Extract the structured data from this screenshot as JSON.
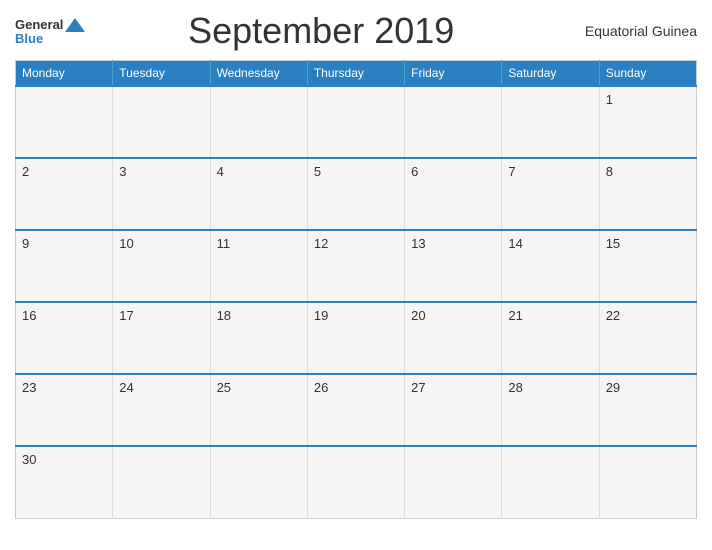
{
  "header": {
    "logo_general": "General",
    "logo_blue": "Blue",
    "title": "September 2019",
    "country": "Equatorial Guinea"
  },
  "days": [
    "Monday",
    "Tuesday",
    "Wednesday",
    "Thursday",
    "Friday",
    "Saturday",
    "Sunday"
  ],
  "weeks": [
    [
      "",
      "",
      "",
      "",
      "",
      "",
      "1"
    ],
    [
      "2",
      "3",
      "4",
      "5",
      "6",
      "7",
      "8"
    ],
    [
      "9",
      "10",
      "11",
      "12",
      "13",
      "14",
      "15"
    ],
    [
      "16",
      "17",
      "18",
      "19",
      "20",
      "21",
      "22"
    ],
    [
      "23",
      "24",
      "25",
      "26",
      "27",
      "28",
      "29"
    ],
    [
      "30",
      "",
      "",
      "",
      "",
      "",
      ""
    ]
  ]
}
